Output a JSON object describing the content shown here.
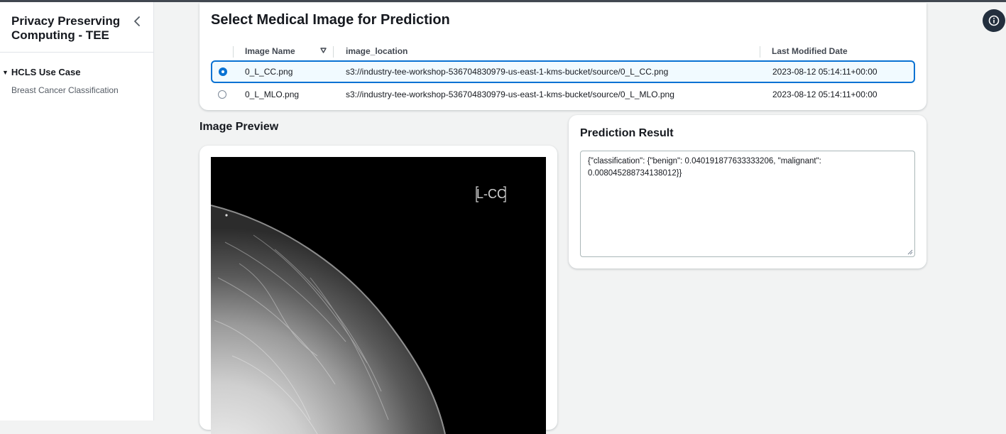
{
  "sidebar": {
    "title": "Privacy Preserving Computing - TEE",
    "section": "HCLS Use Case",
    "items": [
      {
        "label": "Breast Cancer Classification"
      }
    ]
  },
  "table": {
    "title": "Select Medical Image for Prediction",
    "columns": [
      "Image Name",
      "image_location",
      "Last Modified Date"
    ],
    "rows": [
      {
        "name": "0_L_CC.png",
        "location": "s3://industry-tee-workshop-536704830979-us-east-1-kms-bucket/source/0_L_CC.png",
        "modified": "2023-08-12 05:14:11+00:00",
        "selected": true
      },
      {
        "name": "0_L_MLO.png",
        "location": "s3://industry-tee-workshop-536704830979-us-east-1-kms-bucket/source/0_L_MLO.png",
        "modified": "2023-08-12 05:14:11+00:00",
        "selected": false
      }
    ]
  },
  "preview": {
    "title": "Image Preview",
    "image_label": "L-CC"
  },
  "result": {
    "title": "Prediction Result",
    "value": "{\"classification\": {\"benign\": 0.040191877633333206, \"malignant\": 0.008045288734138012}}"
  },
  "colors": {
    "accent": "#0972d3",
    "info_button": "#232f3e",
    "background": "#f2f3f3"
  },
  "icons": [
    "collapse-chevron-icon",
    "info-icon",
    "sort-descending-icon",
    "caret-down-icon",
    "resize-grip-icon"
  ]
}
